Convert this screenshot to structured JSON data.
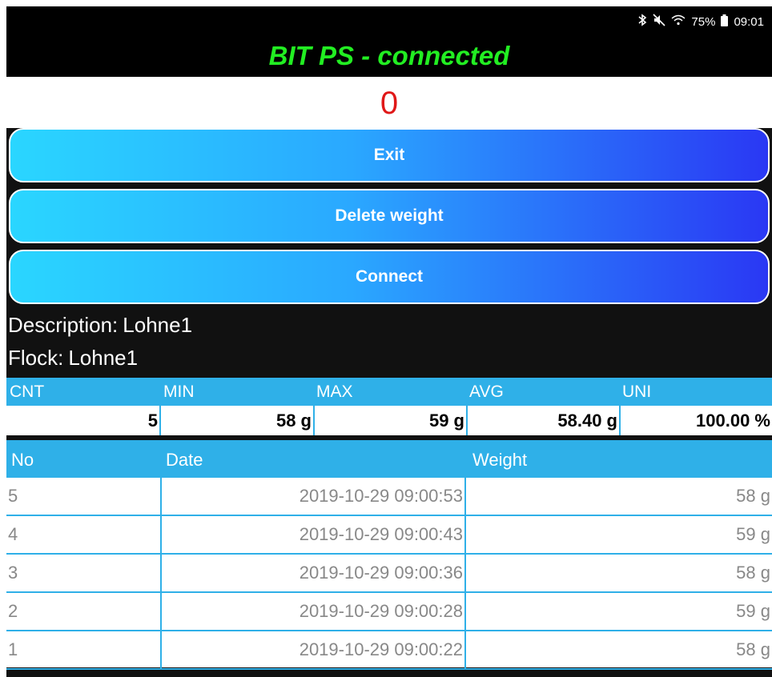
{
  "status_bar": {
    "icons": [
      "bluetooth-icon",
      "mute-icon",
      "wifi-icon",
      "battery-icon"
    ],
    "battery_text": "75%",
    "time": "09:01"
  },
  "app": {
    "title": "BIT PS  - connected",
    "current_weight": "0",
    "title_color": "#22ee22",
    "weight_color": "#e01818"
  },
  "buttons": {
    "exit": "Exit",
    "delete_weight": "Delete weight",
    "connect": "Connect"
  },
  "info": {
    "description_label": "Description:",
    "description_value": "Lohne1",
    "flock_label": "Flock:",
    "flock_value": "Lohne1"
  },
  "stats": {
    "headers": [
      "CNT",
      "MIN",
      "MAX",
      "AVG",
      "UNI"
    ],
    "values": [
      "5",
      "58 g",
      "59 g",
      "58.40 g",
      "100.00 %"
    ]
  },
  "table": {
    "headers": [
      "No",
      "Date",
      "Weight"
    ],
    "rows": [
      {
        "no": "5",
        "date": "2019-10-29 09:00:53",
        "weight": "58 g"
      },
      {
        "no": "4",
        "date": "2019-10-29 09:00:43",
        "weight": "59 g"
      },
      {
        "no": "3",
        "date": "2019-10-29 09:00:36",
        "weight": "58 g"
      },
      {
        "no": "2",
        "date": "2019-10-29 09:00:28",
        "weight": "59 g"
      },
      {
        "no": "1",
        "date": "2019-10-29 09:00:22",
        "weight": "58 g"
      }
    ]
  },
  "colors": {
    "accent_blue": "#2fb0e8",
    "button_gradient_start": "#2ad6ff",
    "button_gradient_end": "#2a38f4"
  }
}
